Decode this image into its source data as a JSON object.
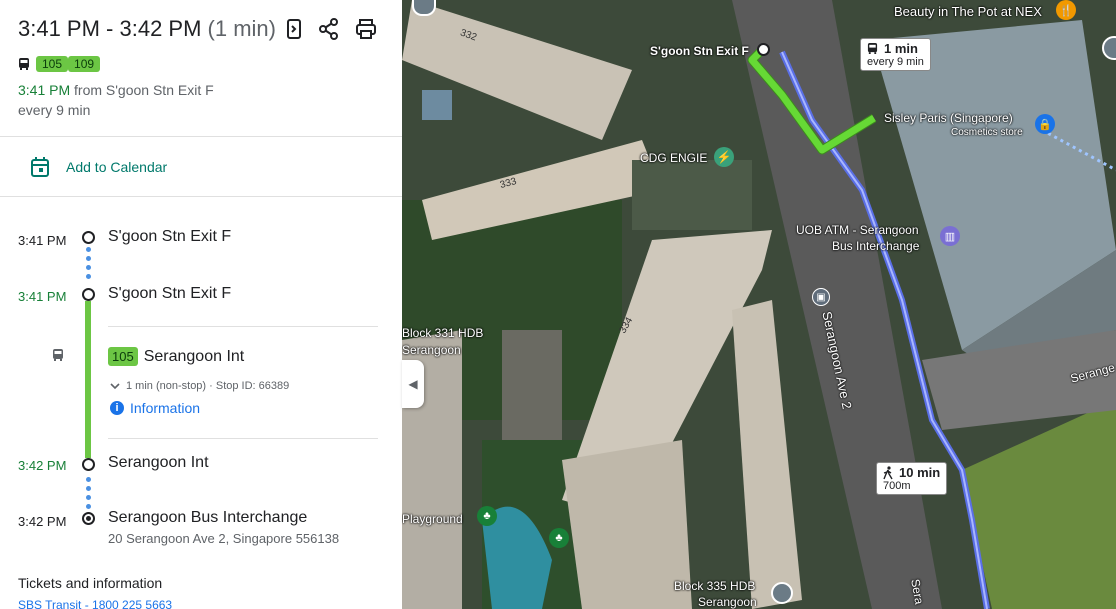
{
  "header": {
    "time_range": "3:41 PM - 3:42 PM",
    "duration": "(1 min)",
    "routes": [
      "105",
      "109"
    ],
    "depart_time": "3:41 PM",
    "depart_from": "from S'goon Stn Exit F",
    "frequency": "every 9 min"
  },
  "actions": {
    "calendar_label": "Add to Calendar"
  },
  "steps": {
    "s1_time": "3:41 PM",
    "s1_name": "S'goon Stn Exit F",
    "s2_time": "3:41 PM",
    "s2_name": "S'goon Stn Exit F",
    "bus_route": "105",
    "bus_dest": "Serangoon Int",
    "bus_details": "1 min (non-stop) · Stop ID: 66389",
    "information": "Information",
    "s3_time": "3:42 PM",
    "s3_name": "Serangoon Int",
    "s4_time": "3:42 PM",
    "s4_name": "Serangoon Bus Interchange",
    "s4_address": "20 Serangoon Ave 2, Singapore 556138"
  },
  "tickets": {
    "heading": "Tickets and information",
    "provider": "SBS Transit - 1800 225 5663"
  },
  "map": {
    "labels": {
      "exit_f": "S'goon Stn Exit F",
      "beauty": "Beauty in The Pot at NEX",
      "sisley": "Sisley Paris (Singapore)",
      "sisley_sub": "Cosmetics store",
      "cdg": "CDG ENGIE",
      "uob": "UOB ATM - Serangoon",
      "uob2": "Bus Interchange",
      "block331a": "Block 331 HDB",
      "block331b": "Serangoon",
      "road": "Serangoon Ave 2",
      "playground": "Playground",
      "block335a": "Block 335 HDB",
      "block335b": "Serangoon",
      "b332": "332",
      "b333": "333",
      "b334": "334",
      "sera_right": "Serange",
      "sera_bottom": "Sera"
    },
    "bus_callout": {
      "duration": "1 min",
      "frequency": "every 9 min"
    },
    "walk_callout": {
      "duration": "10 min",
      "distance": "700m"
    }
  }
}
